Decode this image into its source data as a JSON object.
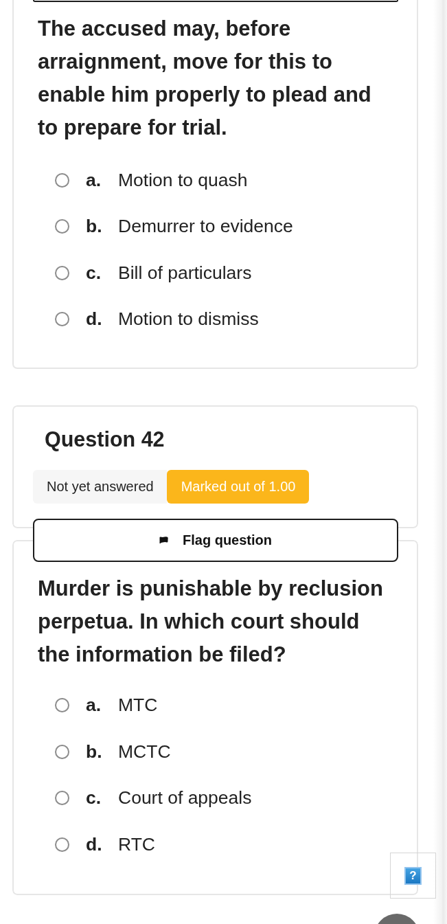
{
  "previous_question": {
    "text": "The accused may, before arraignment, move for this to enable him properly to plead and to prepare for trial.",
    "options": [
      {
        "letter": "a.",
        "label": "Motion to quash",
        "selected": false
      },
      {
        "letter": "b.",
        "label": "Demurrer to evidence",
        "selected": false
      },
      {
        "letter": "c.",
        "label": "Bill of particulars",
        "selected": false
      },
      {
        "letter": "d.",
        "label": "Motion to dismiss",
        "selected": false
      }
    ]
  },
  "question": {
    "title": "Question 42",
    "status": "Not yet answered",
    "marks": "Marked out of 1.00",
    "flag_label": "Flag question",
    "text": "Murder is punishable by reclusion perpetua. In which court should the information be filed?",
    "options": [
      {
        "letter": "a.",
        "label": "MTC",
        "selected": false
      },
      {
        "letter": "b.",
        "label": "MCTC",
        "selected": false
      },
      {
        "letter": "c.",
        "label": "Court of appeals",
        "selected": false
      },
      {
        "letter": "d.",
        "label": "RTC",
        "selected": false
      }
    ]
  },
  "help": {
    "label": "?"
  }
}
